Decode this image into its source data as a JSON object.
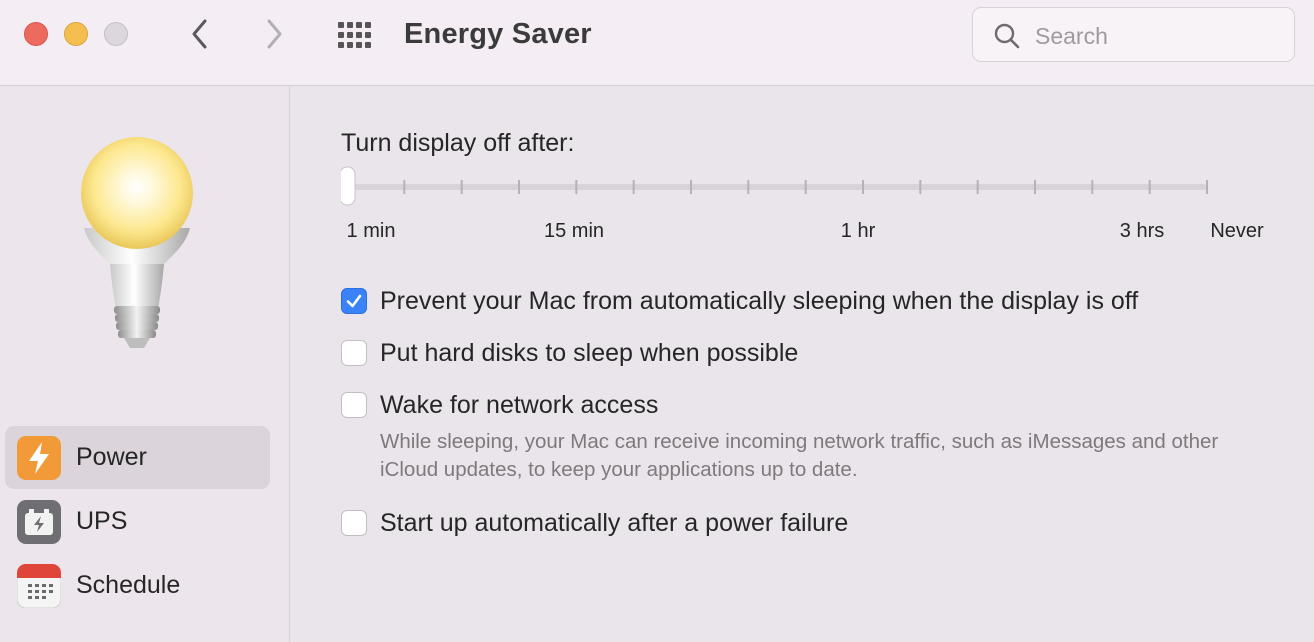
{
  "window": {
    "title": "Energy Saver",
    "search_placeholder": "Search"
  },
  "sidebar": {
    "items": [
      {
        "label": "Power",
        "icon": "power-icon",
        "color": "#f29a38",
        "selected": true
      },
      {
        "label": "UPS",
        "icon": "ups-icon",
        "color": "#6e6e73",
        "selected": false
      },
      {
        "label": "Schedule",
        "icon": "calendar-icon",
        "color": "#e0453a",
        "selected": false
      }
    ]
  },
  "main": {
    "display_off_label": "Turn display off after:",
    "slider": {
      "value": "1 min",
      "stops": 16,
      "position_index": 0,
      "tick_labels": [
        "1 min",
        "15 min",
        "1 hr",
        "3 hrs",
        "Never"
      ]
    },
    "options": [
      {
        "label": "Prevent your Mac from automatically sleeping when the display is off",
        "checked": true
      },
      {
        "label": "Put hard disks to sleep when possible",
        "checked": false
      },
      {
        "label": "Wake for network access",
        "checked": false
      },
      {
        "label": "Start up automatically after a power failure",
        "checked": false
      }
    ],
    "network_help": "While sleeping, your Mac can receive incoming network traffic, such as iMessages and other iCloud updates, to keep your applications up to date."
  },
  "colors": {
    "accent": "#3a82f7",
    "close": "#ed6a5e",
    "minimize": "#f5bf4f",
    "zoom": "#dcd7dc"
  }
}
